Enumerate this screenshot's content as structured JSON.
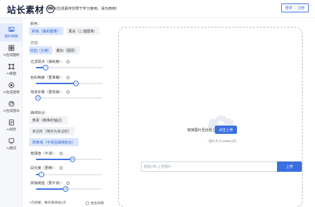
{
  "header": {
    "logo_text": "站长素材",
    "logo_mark": "AI",
    "notice": "所有AI生成素材仅限于学习使用，请勿商用！",
    "login_label": "登录",
    "register_label": "注册"
  },
  "nav": {
    "items": [
      {
        "label": "图片转换",
        "icon": "image-icon"
      },
      {
        "label": "AI生成图标",
        "icon": "ai-icon-icon"
      },
      {
        "label": "AI抠图",
        "icon": "cutout-icon"
      },
      {
        "label": "AI生成音频",
        "icon": "audio-icon"
      },
      {
        "label": "AI生成音乐",
        "icon": "music-icon"
      },
      {
        "label": "AI简历",
        "icon": "resume-icon"
      },
      {
        "label": "AI面试",
        "icon": "interview-icon"
      }
    ],
    "active_index": 0
  },
  "panel": {
    "color_label": "颜色：",
    "color_options": [
      "彩色（真彩图像）",
      "黑白（二值图像）"
    ],
    "mode_label": "方式：",
    "mode_options": [
      "切割（分离）",
      "叠加（图层）"
    ],
    "sliders": [
      {
        "label": "过滤斑点（抽帧度）：",
        "value": 4,
        "display": "4",
        "fraction": 0.15
      },
      {
        "label": "色彩精度（更准确）：",
        "value": 6,
        "display": "6",
        "fraction": 0.6
      },
      {
        "label": "渐变步骤（更快速）：",
        "value": 16,
        "display": "16",
        "fraction": 0.03
      }
    ],
    "curve_label": "曲线拟合：",
    "curve_options": [
      "像素（精准的轴边）",
      "多边形（简化为多边形）",
      "样条线（平滑且曲线拟合）"
    ],
    "curve_selected": 2,
    "sliders2": [
      {
        "label": "角阈值（平滑）：",
        "value": 60,
        "display": "60",
        "fraction": 0.55
      },
      {
        "label": "段长度（更精）：",
        "value": 4,
        "display": "4",
        "fraction": 0.08
      },
      {
        "label": "拼接阈值（更平滑）：",
        "value": 45,
        "display": "45",
        "fraction": 0.45
      }
    ],
    "footer_text": "• 内测版，每日限体验2次",
    "footer_checkbox": "免责声明"
  },
  "main": {
    "drop_text": "拖放图片至此处上传，或",
    "choose_label": "点击上传",
    "size_note": "- 图片大小10MB以内 -",
    "url_placeholder": "粘贴URL上传图片",
    "upload_label": "上传"
  },
  "colors": {
    "accent": "#3b6fe0",
    "accent_bg": "#dbe6fb",
    "logo": "#1b2340"
  }
}
